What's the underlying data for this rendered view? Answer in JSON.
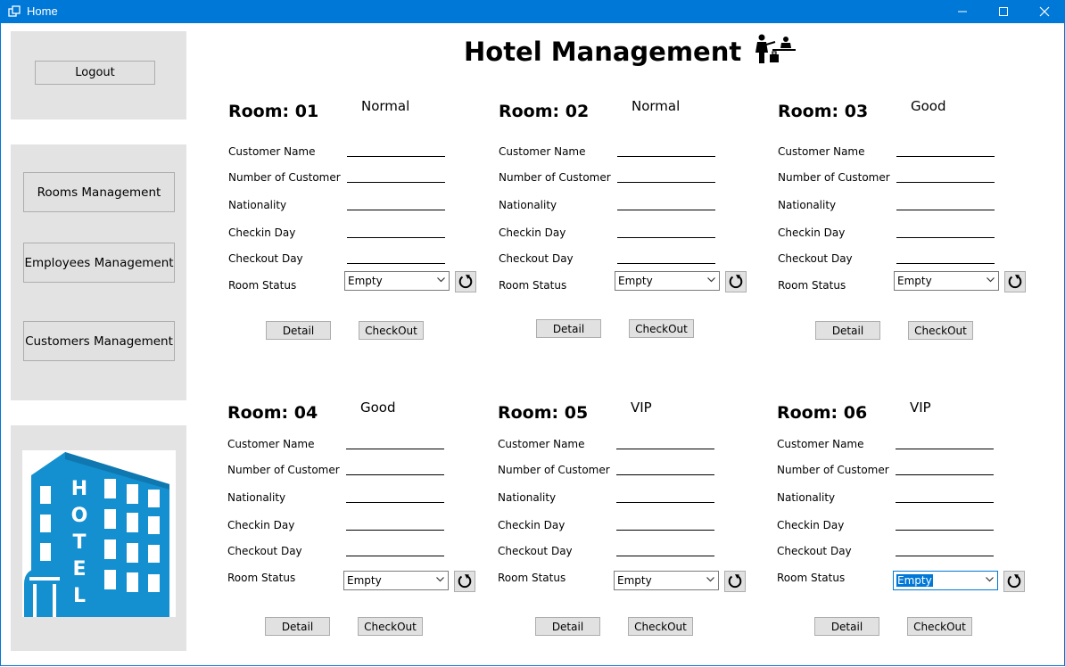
{
  "window": {
    "title": "Home"
  },
  "header": {
    "title": "Hotel Management"
  },
  "sidebar": {
    "logout_label": "Logout",
    "nav": [
      "Rooms Management",
      "Employees Management",
      "Customers Management"
    ],
    "logo_text": "HOTEL"
  },
  "fields": [
    "Customer Name",
    "Number of Customer",
    "Nationality",
    "Checkin Day",
    "Checkout Day",
    "Room Status"
  ],
  "buttons": {
    "detail": "Detail",
    "checkout": "CheckOut"
  },
  "rooms": [
    {
      "title": "Room: 01",
      "type": "Normal",
      "status": "Empty"
    },
    {
      "title": "Room: 02",
      "type": "Normal",
      "status": "Empty"
    },
    {
      "title": "Room: 03",
      "type": "Good",
      "status": "Empty"
    },
    {
      "title": "Room: 04",
      "type": "Good",
      "status": "Empty"
    },
    {
      "title": "Room: 05",
      "type": "VIP",
      "status": "Empty"
    },
    {
      "title": "Room: 06",
      "type": "VIP",
      "status": "Empty",
      "focused": true
    }
  ],
  "colors": {
    "titlebar": "#0078d7",
    "panel": "#e3e3e3",
    "logo": "#1490d0"
  }
}
